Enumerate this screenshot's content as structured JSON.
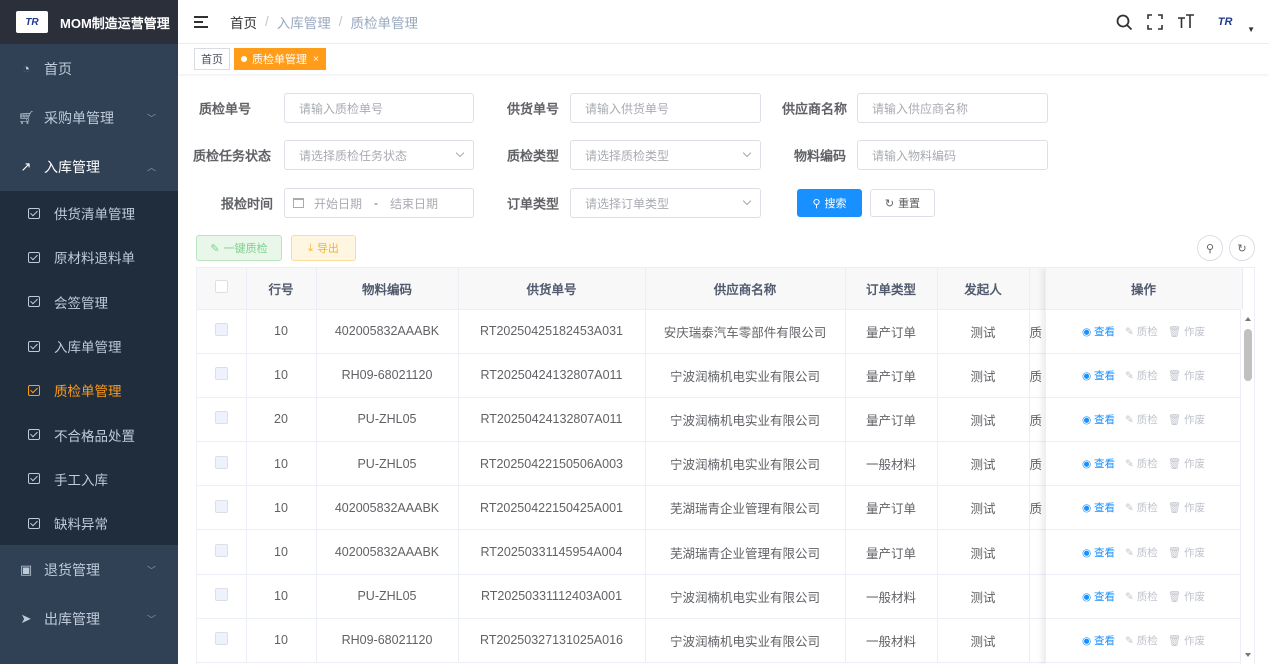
{
  "app": {
    "title": "MOM制造运营管理",
    "logo_text": "TR"
  },
  "sidebar": {
    "items": [
      {
        "label": "首页",
        "icon": "dashboard-icon"
      },
      {
        "label": "采购单管理",
        "icon": "cart-icon"
      },
      {
        "label": "入库管理",
        "icon": "external-link-icon",
        "expanded": true
      }
    ],
    "sub_items": [
      {
        "label": "供货清单管理"
      },
      {
        "label": "原材料退料单"
      },
      {
        "label": "会签管理"
      },
      {
        "label": "入库单管理"
      },
      {
        "label": "质检单管理",
        "active": true
      },
      {
        "label": "不合格品处置"
      },
      {
        "label": "手工入库"
      },
      {
        "label": "缺料异常"
      }
    ],
    "bottom_items": [
      {
        "label": "退货管理",
        "icon": "return-icon"
      },
      {
        "label": "出库管理",
        "icon": "send-icon"
      }
    ]
  },
  "navbar": {
    "breadcrumb": [
      "首页",
      "入库管理",
      "质检单管理"
    ],
    "breadcrumb_sep": "/"
  },
  "tags": [
    {
      "label": "首页"
    },
    {
      "label": "质检单管理",
      "active": true,
      "close": "×"
    }
  ],
  "form": {
    "qc_no": {
      "label": "质检单号",
      "placeholder": "请输入质检单号"
    },
    "supply_no": {
      "label": "供货单号",
      "placeholder": "请输入供货单号"
    },
    "supplier": {
      "label": "供应商名称",
      "placeholder": "请输入供应商名称"
    },
    "task_status": {
      "label": "质检任务状态",
      "placeholder": "请选择质检任务状态"
    },
    "qc_type": {
      "label": "质检类型",
      "placeholder": "请选择质检类型"
    },
    "material_code": {
      "label": "物料编码",
      "placeholder": "请输入物料编码"
    },
    "report_time": {
      "label": "报检时间",
      "start": "开始日期",
      "sep": "-",
      "end": "结束日期"
    },
    "order_type": {
      "label": "订单类型",
      "placeholder": "请选择订单类型"
    },
    "search_btn": "搜索",
    "reset_btn": "重置"
  },
  "toolbar": {
    "batch_qc": "一键质检",
    "export": "导出"
  },
  "table": {
    "headers": [
      "行号",
      "物料编码",
      "供货单号",
      "供应商名称",
      "订单类型",
      "发起人",
      "操作"
    ],
    "ops": {
      "view": "查看",
      "qc": "质检",
      "void": "作废"
    },
    "rows": [
      {
        "line": "10",
        "material": "402005832AAABK",
        "supply_no": "RT20250425182453A031",
        "supplier": "安庆瑞泰汽车零部件有限公司",
        "order_type": "量产订单",
        "initiator": "测试",
        "trunc": "质"
      },
      {
        "line": "10",
        "material": "RH09-68021120",
        "supply_no": "RT20250424132807A011",
        "supplier": "宁波润楠机电实业有限公司",
        "order_type": "量产订单",
        "initiator": "测试",
        "trunc": "质"
      },
      {
        "line": "20",
        "material": "PU-ZHL05",
        "supply_no": "RT20250424132807A011",
        "supplier": "宁波润楠机电实业有限公司",
        "order_type": "量产订单",
        "initiator": "测试",
        "trunc": "质"
      },
      {
        "line": "10",
        "material": "PU-ZHL05",
        "supply_no": "RT20250422150506A003",
        "supplier": "宁波润楠机电实业有限公司",
        "order_type": "一般材料",
        "initiator": "测试",
        "trunc": "质"
      },
      {
        "line": "10",
        "material": "402005832AAABK",
        "supply_no": "RT20250422150425A001",
        "supplier": "芜湖瑞青企业管理有限公司",
        "order_type": "量产订单",
        "initiator": "测试",
        "trunc": "质"
      },
      {
        "line": "10",
        "material": "402005832AAABK",
        "supply_no": "RT20250331145954A004",
        "supplier": "芜湖瑞青企业管理有限公司",
        "order_type": "量产订单",
        "initiator": "测试",
        "trunc": ""
      },
      {
        "line": "10",
        "material": "PU-ZHL05",
        "supply_no": "RT20250331112403A001",
        "supplier": "宁波润楠机电实业有限公司",
        "order_type": "一般材料",
        "initiator": "测试",
        "trunc": ""
      },
      {
        "line": "10",
        "material": "RH09-68021120",
        "supply_no": "RT20250327131025A016",
        "supplier": "宁波润楠机电实业有限公司",
        "order_type": "一般材料",
        "initiator": "测试",
        "trunc": ""
      }
    ]
  },
  "colors": {
    "accent": "#ff9c1a",
    "primary": "#1890ff",
    "sidebar": "#304156"
  }
}
